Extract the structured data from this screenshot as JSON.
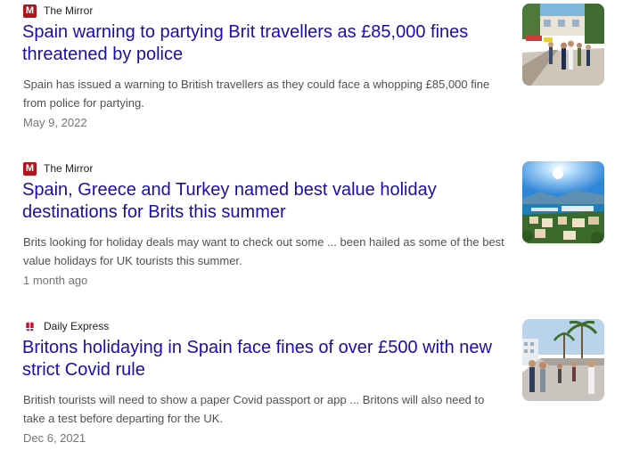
{
  "results": [
    {
      "source": "The Mirror",
      "favicon_icon": "mirror-logo-icon",
      "favicon_letter": "M",
      "title": "Spain warning to partying Brit travellers as £85,000 fines threatened by police",
      "snippet": "Spain has issued a warning to British travellers as they could face a whopping £85,000 fine from police for partying.",
      "date": "May 9, 2022"
    },
    {
      "source": "The Mirror",
      "favicon_icon": "mirror-logo-icon",
      "favicon_letter": "M",
      "title": "Spain, Greece and Turkey named best value holiday destinations for Brits this summer",
      "snippet": "Brits looking for holiday deals may want to check out some ... been hailed as some of the best value holidays for UK tourists this summer.",
      "date": "1 month ago"
    },
    {
      "source": "Daily Express",
      "favicon_icon": "daily-express-logo-icon",
      "title": "Britons holidaying in Spain face fines of over £500 with new strict Covid rule",
      "snippet": "British tourists will need to show a paper Covid passport or app ... Britons will also need to take a test before departing for the UK.",
      "date": "Dec 6, 2021"
    }
  ],
  "colors": {
    "title_link": "#1a0dab",
    "snippet": "#4d5156",
    "date": "#70757a",
    "mirror_red": "#b3131a"
  }
}
